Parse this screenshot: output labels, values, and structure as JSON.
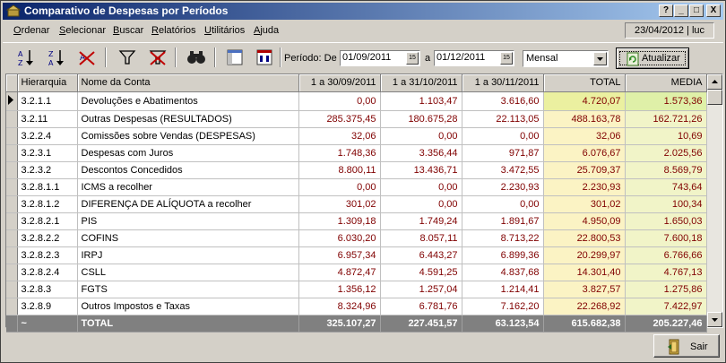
{
  "window": {
    "title": "Comparativo de Despesas por Períodos"
  },
  "titlebar_buttons": [
    "?",
    "_",
    "□",
    "X"
  ],
  "menu": [
    "Ordenar",
    "Selecionar",
    "Buscar",
    "Relatórios",
    "Utilitários",
    "Ajuda"
  ],
  "status": "23/04/2012 | luc",
  "toolbar": {
    "periodo_label": "Período: De",
    "date_from": "01/09/2011",
    "sep_label": "a",
    "date_to": "01/12/2011",
    "period_type": "Mensal",
    "refresh_label": "Atualizar"
  },
  "table": {
    "columns": [
      "Hierarquia",
      "Nome da Conta",
      "1 a 30/09/2011",
      "1 a 31/10/2011",
      "1 a 30/11/2011",
      "TOTAL",
      "MEDIA"
    ],
    "rows": [
      [
        "3.2.1.1",
        "Devoluções e Abatimentos",
        "0,00",
        "1.103,47",
        "3.616,60",
        "4.720,07",
        "1.573,36"
      ],
      [
        "3.2.11",
        "Outras Despesas (RESULTADOS)",
        "285.375,45",
        "180.675,28",
        "22.113,05",
        "488.163,78",
        "162.721,26"
      ],
      [
        "3.2.2.4",
        "Comissões sobre Vendas (DESPESAS)",
        "32,06",
        "0,00",
        "0,00",
        "32,06",
        "10,69"
      ],
      [
        "3.2.3.1",
        "Despesas com Juros",
        "1.748,36",
        "3.356,44",
        "971,87",
        "6.076,67",
        "2.025,56"
      ],
      [
        "3.2.3.2",
        "Descontos Concedidos",
        "8.800,11",
        "13.436,71",
        "3.472,55",
        "25.709,37",
        "8.569,79"
      ],
      [
        "3.2.8.1.1",
        "ICMS a recolher",
        "0,00",
        "0,00",
        "2.230,93",
        "2.230,93",
        "743,64"
      ],
      [
        "3.2.8.1.2",
        "DIFERENÇA DE ALÍQUOTA a recolher",
        "301,02",
        "0,00",
        "0,00",
        "301,02",
        "100,34"
      ],
      [
        "3.2.8.2.1",
        "PIS",
        "1.309,18",
        "1.749,24",
        "1.891,67",
        "4.950,09",
        "1.650,03"
      ],
      [
        "3.2.8.2.2",
        "COFINS",
        "6.030,20",
        "8.057,11",
        "8.713,22",
        "22.800,53",
        "7.600,18"
      ],
      [
        "3.2.8.2.3",
        "IRPJ",
        "6.957,34",
        "6.443,27",
        "6.899,36",
        "20.299,97",
        "6.766,66"
      ],
      [
        "3.2.8.2.4",
        "CSLL",
        "4.872,47",
        "4.591,25",
        "4.837,68",
        "14.301,40",
        "4.767,13"
      ],
      [
        "3.2.8.3",
        "FGTS",
        "1.356,12",
        "1.257,04",
        "1.214,41",
        "3.827,57",
        "1.275,86"
      ],
      [
        "3.2.8.9",
        "Outros Impostos e Taxas",
        "8.324,96",
        "6.781,76",
        "7.162,20",
        "22.268,92",
        "7.422,97"
      ]
    ],
    "totals": [
      "~",
      "TOTAL",
      "325.107,27",
      "227.451,57",
      "63.123,54",
      "615.682,38",
      "205.227,46"
    ]
  },
  "exit_label": "Sair",
  "colors": {
    "title_start": "#0a246a",
    "title_end": "#a6caf0",
    "value_text": "#800000",
    "total_bg": "#fbf3c4",
    "media_bg": "#f1f4c8",
    "sum_row_bg": "#808080"
  }
}
